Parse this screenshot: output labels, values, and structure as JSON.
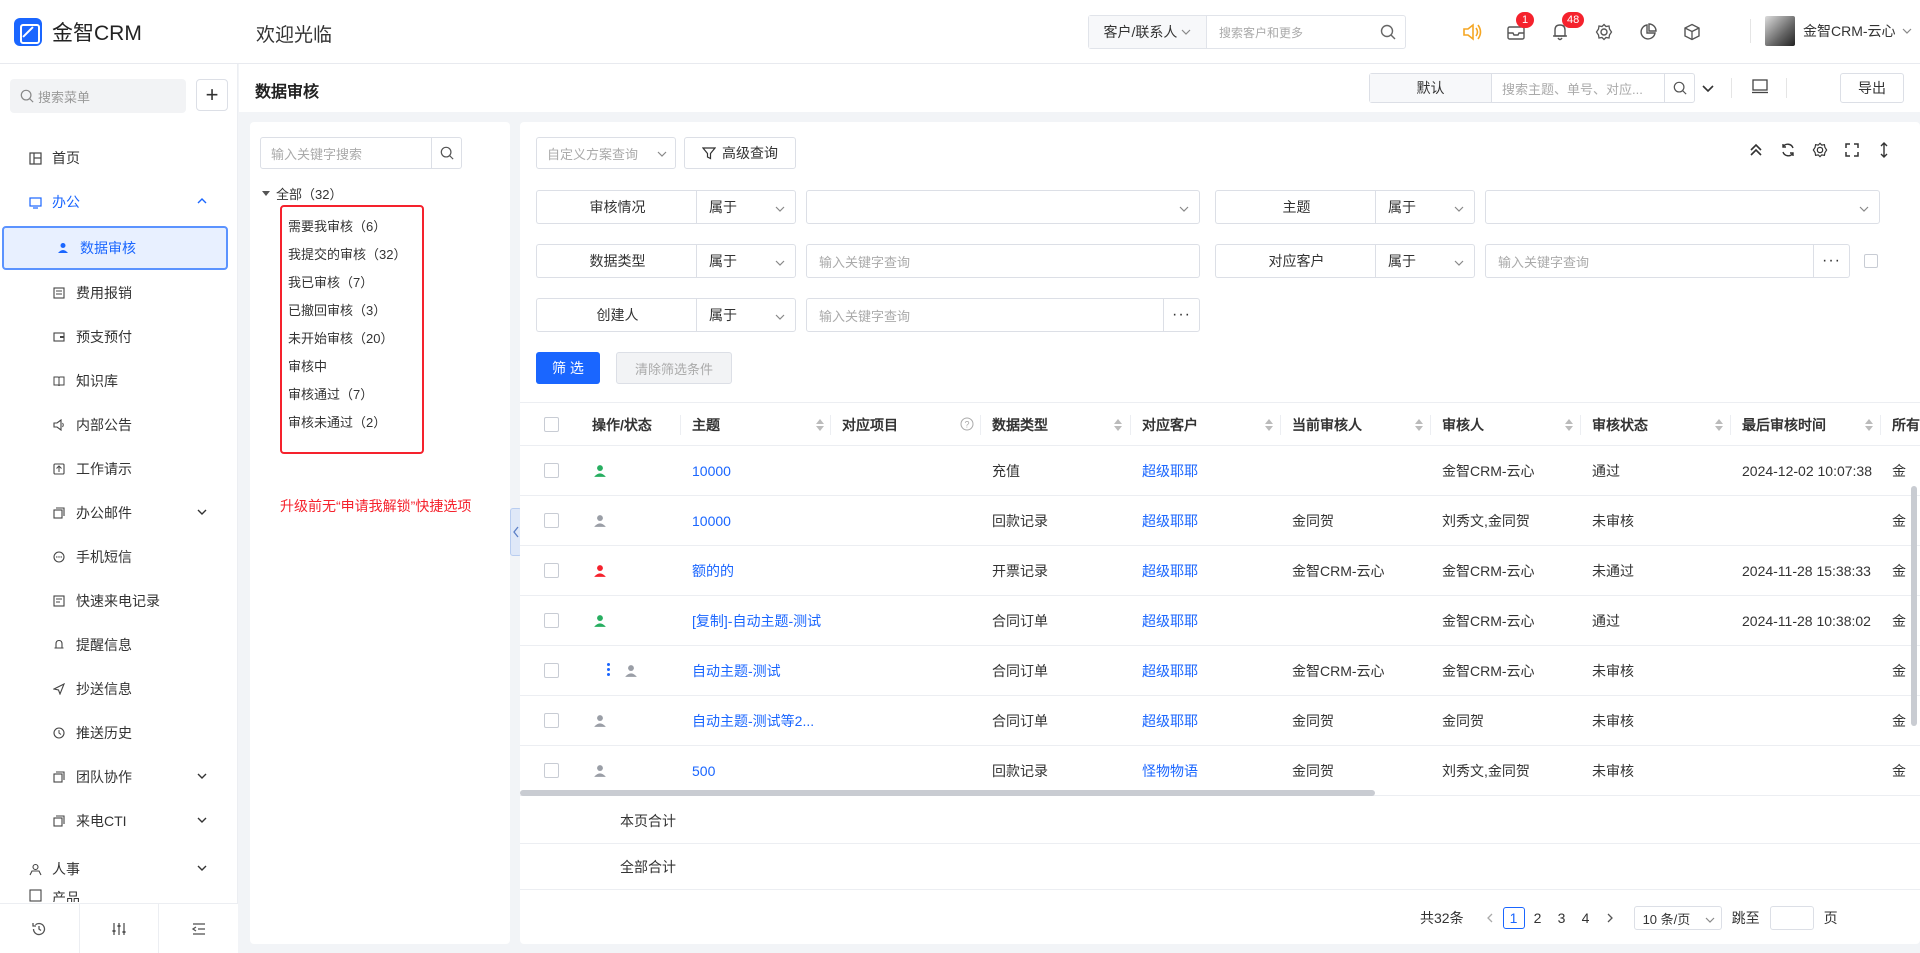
{
  "brand": {
    "name": "金智CRM",
    "accent": "#1a66ff"
  },
  "header": {
    "welcome": "欢迎光临",
    "search_scope": "客户/联系人",
    "search_placeholder": "搜索客户和更多",
    "mail_badge": "1",
    "bell_badge": "48",
    "user_name": "金智CRM-云心"
  },
  "sidebar": {
    "search_placeholder": "搜索菜单",
    "items": [
      {
        "label": "首页",
        "icon": "home-icon"
      },
      {
        "label": "办公",
        "icon": "office-icon"
      },
      {
        "label": "数据审核",
        "icon": "person-icon"
      },
      {
        "label": "费用报销",
        "icon": "receipt-icon"
      },
      {
        "label": "预支预付",
        "icon": "wallet-icon"
      },
      {
        "label": "知识库",
        "icon": "book-icon"
      },
      {
        "label": "内部公告",
        "icon": "speaker-icon"
      },
      {
        "label": "工作请示",
        "icon": "upload-icon"
      },
      {
        "label": "办公邮件",
        "icon": "mail-icon"
      },
      {
        "label": "手机短信",
        "icon": "sms-icon"
      },
      {
        "label": "快速来电记录",
        "icon": "phone-icon"
      },
      {
        "label": "提醒信息",
        "icon": "bell-icon"
      },
      {
        "label": "抄送信息",
        "icon": "send-icon"
      },
      {
        "label": "推送历史",
        "icon": "clock-icon"
      },
      {
        "label": "团队协作",
        "icon": "team-icon"
      },
      {
        "label": "来电CTI",
        "icon": "cti-icon"
      },
      {
        "label": "人事",
        "icon": "hr-icon"
      },
      {
        "label": "产品",
        "icon": "product-icon"
      }
    ]
  },
  "page": {
    "title": "数据审核",
    "scheme_default": "默认",
    "search_placeholder": "搜索主题、单号、对应...",
    "export_label": "导出"
  },
  "tree": {
    "search_placeholder": "输入关键字搜索",
    "root": "全部（32）",
    "nodes": [
      "需要我审核（6）",
      "我提交的审核（32）",
      "我已审核（7）",
      "已撤回审核（3）",
      "未开始审核（20）",
      "审核中",
      "审核通过（7）",
      "审核未通过（2）"
    ],
    "annotation": "升级前无“申请我解锁”快捷选项"
  },
  "filters": {
    "scheme_placeholder": "自定义方案查询",
    "advanced_label": "高级查询",
    "rows": [
      {
        "label": "审核情况",
        "op": "属于",
        "value": ""
      },
      {
        "label": "主题",
        "op": "属于",
        "value": ""
      },
      {
        "label": "数据类型",
        "op": "属于",
        "value": "输入关键字查询"
      },
      {
        "label": "对应客户",
        "op": "属于",
        "value": "输入关键字查询"
      },
      {
        "label": "创建人",
        "op": "属于",
        "value": "输入关键字查询"
      }
    ],
    "filter_btn": "筛 选",
    "clear_btn": "清除筛选条件"
  },
  "table": {
    "columns": [
      "操作/状态",
      "主题",
      "对应项目",
      "数据类型",
      "对应客户",
      "当前审核人",
      "审核人",
      "审核状态",
      "最后审核时间",
      "所有"
    ],
    "rows": [
      {
        "status": "green",
        "subject": "10000",
        "project": "",
        "type": "充值",
        "customer": "超级耶耶",
        "current": "",
        "auditor": "金智CRM-云心",
        "state": "通过",
        "time": "2024-12-02 10:07:38",
        "owner": "金"
      },
      {
        "status": "gray",
        "subject": "10000",
        "project": "",
        "type": "回款记录",
        "customer": "超级耶耶",
        "current": "金同贺",
        "auditor": "刘秀文,金同贺",
        "state": "未审核",
        "time": "",
        "owner": "金"
      },
      {
        "status": "red",
        "subject": "额的的",
        "project": "",
        "type": "开票记录",
        "customer": "超级耶耶",
        "current": "金智CRM-云心",
        "auditor": "金智CRM-云心",
        "state": "未通过",
        "time": "2024-11-28 15:38:33",
        "owner": "金"
      },
      {
        "status": "green",
        "subject": "[复制]-自动主题-测试",
        "project": "",
        "type": "合同订单",
        "customer": "超级耶耶",
        "current": "",
        "auditor": "金智CRM-云心",
        "state": "通过",
        "time": "2024-11-28 10:38:02",
        "owner": "金"
      },
      {
        "status": "gray",
        "subject": "自动主题-测试",
        "project": "",
        "type": "合同订单",
        "customer": "超级耶耶",
        "current": "金智CRM-云心",
        "auditor": "金智CRM-云心",
        "state": "未审核",
        "time": "",
        "owner": "金"
      },
      {
        "status": "gray",
        "subject": "自动主题-测试等2...",
        "project": "",
        "type": "合同订单",
        "customer": "超级耶耶",
        "current": "金同贺",
        "auditor": "金同贺",
        "state": "未审核",
        "time": "",
        "owner": "金"
      },
      {
        "status": "gray",
        "subject": "500",
        "project": "",
        "type": "回款记录",
        "customer": "怪物物语",
        "current": "金同贺",
        "auditor": "刘秀文,金同贺",
        "state": "未审核",
        "time": "",
        "owner": "金"
      }
    ],
    "page_total_label": "本页合计",
    "all_total_label": "全部合计"
  },
  "pagination": {
    "total": "共32条",
    "pages": [
      "1",
      "2",
      "3",
      "4"
    ],
    "page_size": "10 条/页",
    "jump_label": "跳至",
    "page_unit": "页"
  },
  "status_colors": {
    "green": "#27ae60",
    "gray": "#9a9ea6",
    "red": "#f5222d"
  }
}
